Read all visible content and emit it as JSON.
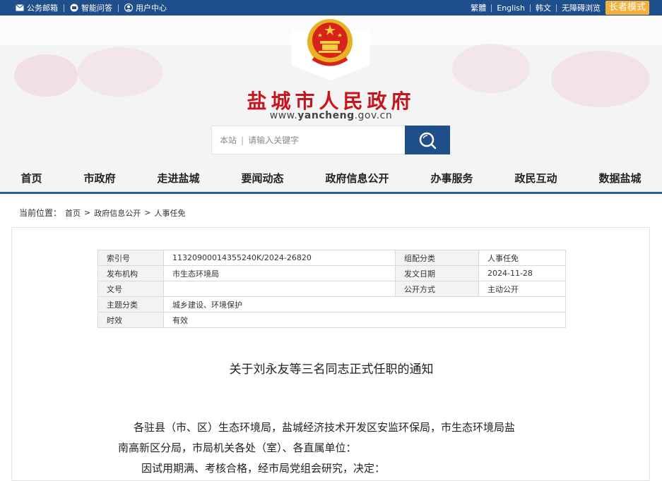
{
  "topbar": {
    "left_links": [
      {
        "label": "公务邮箱",
        "icon": "mail-icon"
      },
      {
        "label": "智能问答",
        "icon": "robot-icon"
      },
      {
        "label": "用户中心",
        "icon": "user-icon"
      }
    ],
    "right_links": [
      "繁體",
      "English",
      "韩文",
      "无障碍浏览"
    ],
    "elder_mode": "长者模式"
  },
  "header": {
    "title": "盐城市人民政府",
    "domain_prefix": "www.",
    "domain_main": "yancheng",
    "domain_suffix": ".gov.cn"
  },
  "search": {
    "scope": "本站",
    "placeholder": "请输入关键字"
  },
  "nav": {
    "items": [
      "首页",
      "市政府",
      "走进盐城",
      "要闻动态",
      "政府信息公开",
      "办事服务",
      "政民互动",
      "数据盐城"
    ]
  },
  "breadcrumb": {
    "label": "当前位置：",
    "items": [
      "首页",
      "政府信息公开",
      "人事任免"
    ],
    "separator": ">"
  },
  "meta": {
    "index_label": "索引号",
    "index_value": "11320900014355240K/2024-26820",
    "category_label": "组配分类",
    "category_value": "人事任免",
    "issuer_label": "发布机构",
    "issuer_value": "市生态环境局",
    "date_label": "发文日期",
    "date_value": "2024-11-28",
    "docno_label": "文号",
    "docno_value": "",
    "open_label": "公开方式",
    "open_value": "主动公开",
    "topic_label": "主题分类",
    "topic_value": "城乡建设、环境保护",
    "valid_label": "时效",
    "valid_value": "有效"
  },
  "document": {
    "title": "关于刘永友等三名同志正式任职的通知",
    "para1_line1": "各驻县（市、区）生态环境局，盐城经济技术开发区安监环保局，市生态环境局盐",
    "para1_line2": "南高新区分局，市局机关各处（室）、各直属单位：",
    "para2": "因试用期满、考核合格，经市局党组会研究，决定："
  },
  "colors": {
    "topbar": "#1f4f8a",
    "title_red": "#c8151d",
    "nav_border": "#2c5d97",
    "elder": "#f1b13a"
  }
}
